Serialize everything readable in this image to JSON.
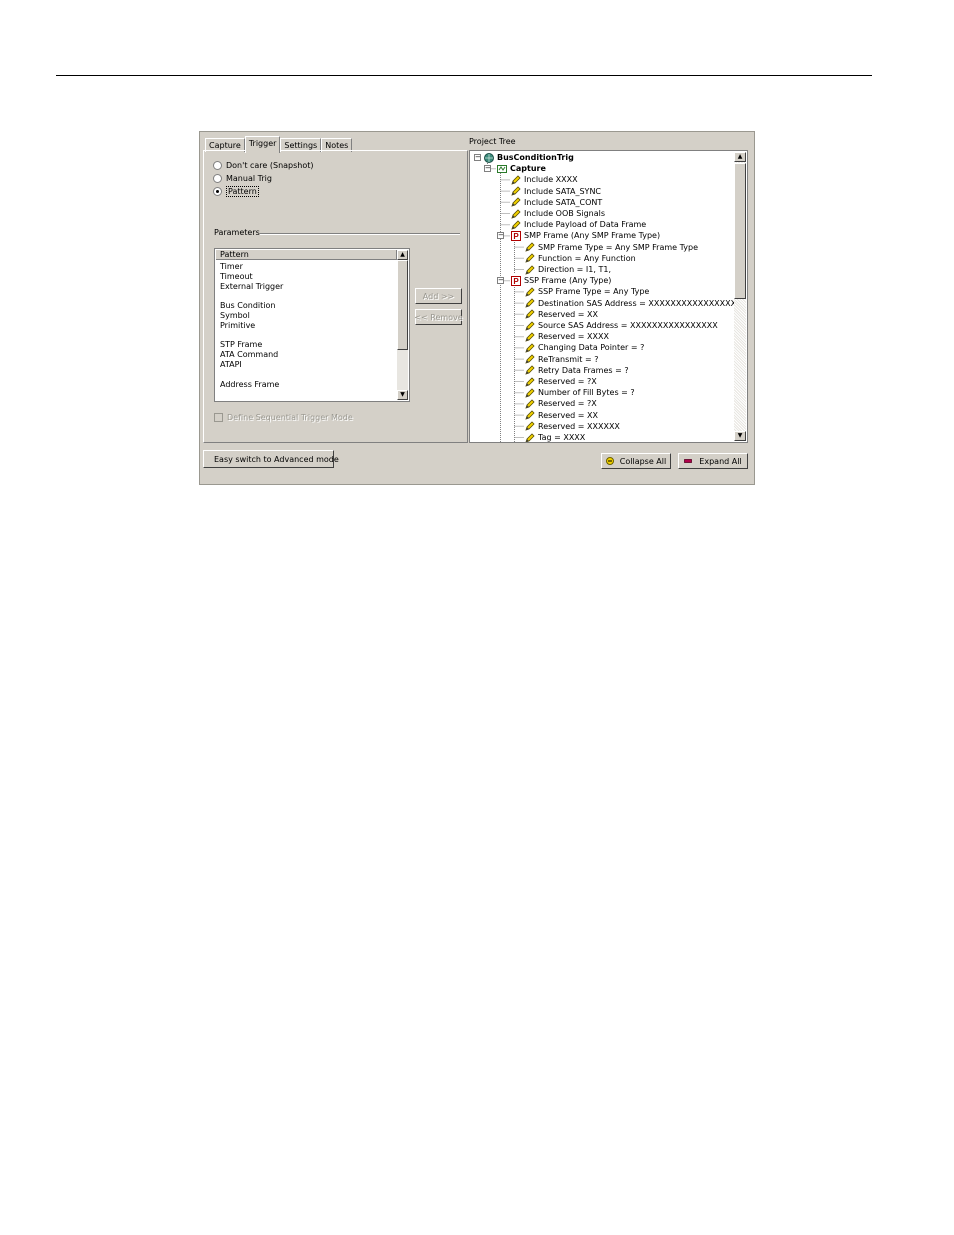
{
  "dialog": {
    "tabs": [
      "Capture",
      "Trigger",
      "Settings",
      "Notes"
    ],
    "active_tab": "Trigger",
    "radios": [
      {
        "label": "Don't care (Snapshot)",
        "checked": false
      },
      {
        "label": "Manual Trig",
        "checked": false
      },
      {
        "label": "Pattern",
        "checked": true
      }
    ],
    "parameters_label": "Parameters",
    "pattern_list": {
      "header": "Pattern",
      "items": [
        "Timer",
        "Timeout",
        "External Trigger",
        "",
        "Bus Condition",
        "Symbol",
        "Primitive",
        "",
        "STP Frame",
        "ATA Command",
        "ATAPI",
        "",
        "Address Frame"
      ]
    },
    "add_button": "Add >>",
    "remove_button": "<< Remove",
    "sequential_checkbox": "Define Sequential Trigger Mode",
    "project_tree_label": "Project Tree",
    "tree": [
      {
        "label": "BusConditionTrig",
        "icon": "globe-icon",
        "level": 0,
        "bold": true
      },
      {
        "label": "Capture",
        "icon": "capture-icon",
        "level": 1,
        "bold": true
      },
      {
        "label": "Include XXXX",
        "icon": "pencil-icon",
        "level": 2
      },
      {
        "label": "Include SATA_SYNC",
        "icon": "pencil-icon",
        "level": 2
      },
      {
        "label": "Include SATA_CONT",
        "icon": "pencil-icon",
        "level": 2
      },
      {
        "label": "Include OOB Signals",
        "icon": "pencil-icon",
        "level": 2
      },
      {
        "label": "Include Payload of Data Frame",
        "icon": "pencil-icon",
        "level": 2
      },
      {
        "label": "SMP Frame (Any SMP Frame Type)",
        "icon": "p-icon",
        "level": 2
      },
      {
        "label": "SMP Frame Type = Any SMP Frame Type",
        "icon": "pencil-icon",
        "level": 3
      },
      {
        "label": "Function = Any Function",
        "icon": "pencil-icon",
        "level": 3
      },
      {
        "label": "Direction = I1, T1,",
        "icon": "pencil-icon",
        "level": 3
      },
      {
        "label": "SSP Frame (Any Type)",
        "icon": "p-icon",
        "level": 2
      },
      {
        "label": "SSP Frame Type = Any Type",
        "icon": "pencil-icon",
        "level": 3
      },
      {
        "label": "Destination SAS Address = XXXXXXXXXXXXXXXX",
        "icon": "pencil-icon",
        "level": 3
      },
      {
        "label": "Reserved = XX",
        "icon": "pencil-icon",
        "level": 3
      },
      {
        "label": "Source SAS Address = XXXXXXXXXXXXXXXX",
        "icon": "pencil-icon",
        "level": 3
      },
      {
        "label": "Reserved = XXXX",
        "icon": "pencil-icon",
        "level": 3
      },
      {
        "label": "Changing Data Pointer = ?",
        "icon": "pencil-icon",
        "level": 3
      },
      {
        "label": "ReTransmit = ?",
        "icon": "pencil-icon",
        "level": 3
      },
      {
        "label": "Retry Data Frames = ?",
        "icon": "pencil-icon",
        "level": 3
      },
      {
        "label": "Reserved = ?X",
        "icon": "pencil-icon",
        "level": 3
      },
      {
        "label": "Number of Fill Bytes = ?",
        "icon": "pencil-icon",
        "level": 3
      },
      {
        "label": "Reserved = ?X",
        "icon": "pencil-icon",
        "level": 3
      },
      {
        "label": "Reserved = XX",
        "icon": "pencil-icon",
        "level": 3
      },
      {
        "label": "Reserved = XXXXXX",
        "icon": "pencil-icon",
        "level": 3
      },
      {
        "label": "Tag = XXXX",
        "icon": "pencil-icon",
        "level": 3
      }
    ],
    "advanced_button": "Easy switch to Advanced mode",
    "collapse_button": "Collapse All",
    "expand_button": "Expand All"
  }
}
